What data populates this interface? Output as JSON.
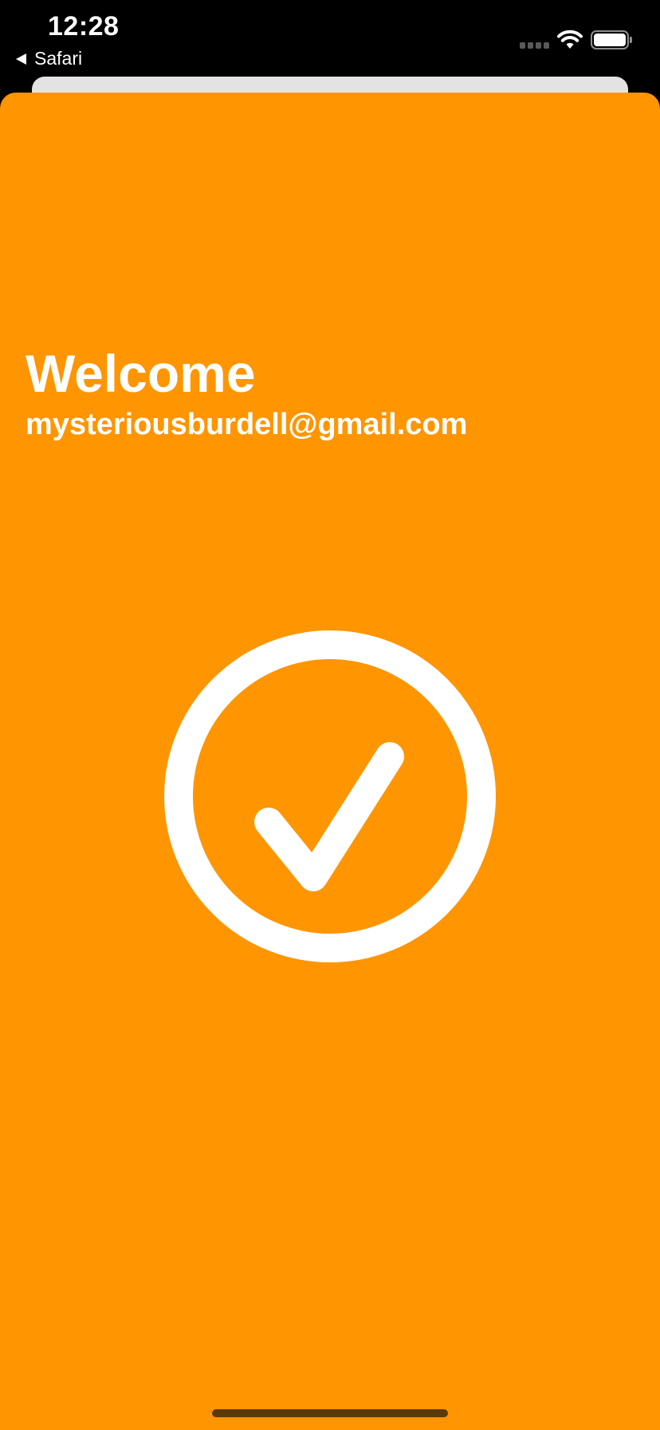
{
  "status_bar": {
    "time": "12:28",
    "back_app": "Safari",
    "icons": [
      "cellular-signal-icon",
      "wifi-icon",
      "battery-icon"
    ]
  },
  "welcome": {
    "title": "Welcome",
    "email": "mysteriousburdell@gmail.com"
  },
  "success_icon": "checkmark-circle-icon",
  "colors": {
    "sheet_background": "#ff9500",
    "foreground": "#ffffff",
    "status_bar_background": "#000000"
  }
}
